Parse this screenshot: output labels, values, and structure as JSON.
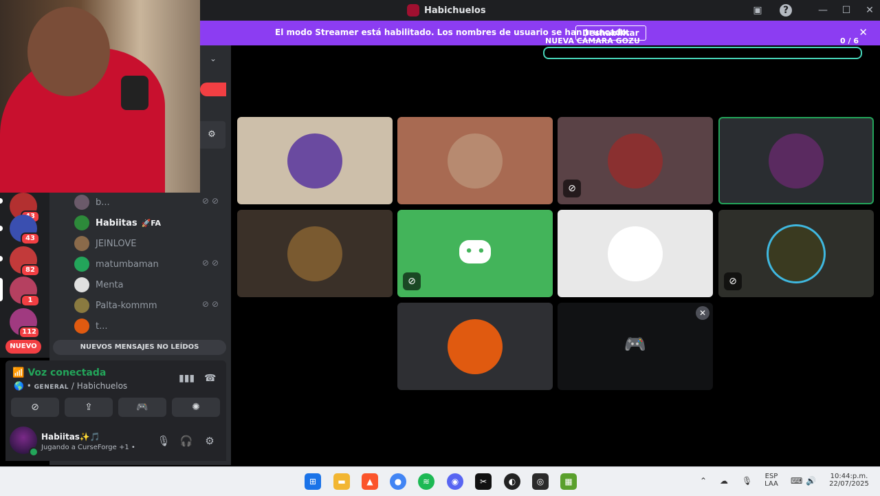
{
  "window": {
    "title": "Habichuelos"
  },
  "banner": {
    "message": "El modo Streamer está habilitado. Los nombres de usuario se han truncado.",
    "disable_label": "Deshabilitar"
  },
  "overlay": {
    "camera_label": "NUEVA CÁMARA GOZU",
    "camera_count": "0 / 6",
    "camera_progress": 0
  },
  "servers": [
    {
      "badge": "43",
      "color": "#b33030"
    },
    {
      "badge": "43",
      "color": "#3a4fb0"
    },
    {
      "badge": "82",
      "color": "#c23a3a"
    },
    {
      "badge": "1",
      "color": "#b54060"
    },
    {
      "badge": "112",
      "color": "#a03a80"
    }
  ],
  "members": [
    {
      "name": "b...",
      "color": "#6b5a6a",
      "muted": true
    },
    {
      "name": "Habiitas",
      "tag": "🚀FA",
      "color": "#2d8a3a",
      "active": true,
      "muted": false
    },
    {
      "name": "JEINLOVE",
      "color": "#8a6a4a",
      "muted": false
    },
    {
      "name": "matumbaman",
      "color": "#23a55a",
      "muted": true
    },
    {
      "name": "Menta",
      "color": "#e0e0e0",
      "muted": false
    },
    {
      "name": "Palta-kommm",
      "color": "#8a7a40",
      "muted": true
    },
    {
      "name": "t...",
      "color": "#e05a10",
      "muted": false
    }
  ],
  "nav": {
    "new_label": "NUEVO",
    "new_messages": "NUEVOS MENSAJES NO LEÍDOS"
  },
  "voice": {
    "status": "Voz conectada",
    "server": "GENERAL",
    "separator": "/",
    "channel": "Habichuelos"
  },
  "user": {
    "name": "Habiitas✨🎵",
    "activity": "Jugando a CurseForge +1 •"
  },
  "tiles": [
    {
      "bg": "#cdbfaa",
      "avatar": "#6a4aa0",
      "muted": false,
      "speaking": false
    },
    {
      "bg": "#a86a52",
      "avatar": "#b78a70",
      "muted": false,
      "speaking": false
    },
    {
      "bg": "#5a4246",
      "avatar": "#8a3030",
      "muted": true,
      "speaking": false
    },
    {
      "bg": "#2a2d31",
      "avatar": "#5a2a60",
      "muted": false,
      "speaking": true
    },
    {
      "bg": "#3a3028",
      "avatar": "#7a5a30",
      "muted": false,
      "speaking": false
    },
    {
      "bg": "#43b45a",
      "avatar": "none",
      "muted": true,
      "speaking": false,
      "discord": true
    },
    {
      "bg": "#e8e8e8",
      "avatar": "#ffffff",
      "muted": false,
      "speaking": false
    },
    {
      "bg": "#2e2f2a",
      "avatar": "#3a3a20",
      "muted": true,
      "speaking": false,
      "ring": true
    },
    {
      "bg": "#2e2f33",
      "avatar": "#e05a10",
      "muted": false,
      "speaking": false
    },
    {
      "bg": "#111214",
      "avatar": "none",
      "muted": false,
      "speaking": false,
      "game": true
    }
  ],
  "clock": {
    "time": "10:44:p.m.",
    "date": "22/07/2025",
    "lang": "ESP",
    "layout": "LAA"
  }
}
